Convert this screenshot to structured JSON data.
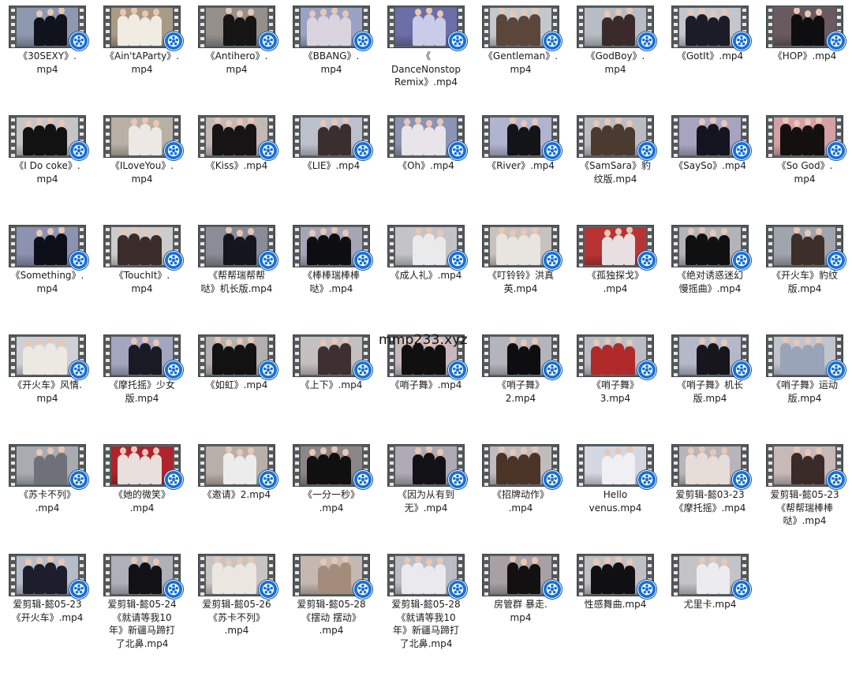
{
  "watermark": "mmp233.xyz",
  "colors": {
    "badge_blue": "#1670d6",
    "film_strip": "#55595c",
    "selection": "none"
  },
  "icons": {
    "file_type_badge": "video-reel-icon",
    "thumbnail_frame": "film-strip-icon"
  },
  "files": [
    {
      "lines": [
        "《30SEXY》.",
        "mp4"
      ],
      "bg": "#8e98b0",
      "fig": "#10131c"
    },
    {
      "lines": [
        "《Ain'tAParty》.",
        "mp4"
      ],
      "bg": "#a89a84",
      "fig": "#f0ece4"
    },
    {
      "lines": [
        "《Antihero》.",
        "mp4"
      ],
      "bg": "#948f8a",
      "fig": "#151515"
    },
    {
      "lines": [
        "《BBANG》.",
        "mp4"
      ],
      "bg": "#9aa2c4",
      "fig": "#d9d4dd"
    },
    {
      "lines": [
        "《",
        "DanceNonstop",
        "Remix》.mp4"
      ],
      "bg": "#6c6ea8",
      "fig": "#c9cbe8"
    },
    {
      "lines": [
        "《Gentleman》.",
        "mp4"
      ],
      "bg": "#c4c8cc",
      "fig": "#5a463a"
    },
    {
      "lines": [
        "《GodBoy》.",
        "mp4"
      ],
      "bg": "#b8bcc4",
      "fig": "#3a2a2a"
    },
    {
      "lines": [
        "《GotIt》.mp4"
      ],
      "bg": "#c4c6cc",
      "fig": "#1c1c28"
    },
    {
      "lines": [
        "《HOP》.mp4"
      ],
      "bg": "#6a5a60",
      "fig": "#0e0e10"
    },
    {
      "lines": [
        "《I Do coke》.",
        "mp4"
      ],
      "bg": "#c6c4c4",
      "fig": "#121212"
    },
    {
      "lines": [
        "《ILoveYou》.",
        "mp4"
      ],
      "bg": "#b8b0a4",
      "fig": "#ece8e4"
    },
    {
      "lines": [
        "《Kiss》.mp4"
      ],
      "bg": "#c4b8b4",
      "fig": "#161414"
    },
    {
      "lines": [
        "《LIE》.mp4"
      ],
      "bg": "#bcc0cc",
      "fig": "#3a2e2e"
    },
    {
      "lines": [
        "《Oh》.mp4"
      ],
      "bg": "#8c94b4",
      "fig": "#e8e4e8"
    },
    {
      "lines": [
        "《River》.mp4"
      ],
      "bg": "#b0b4d0",
      "fig": "#121418"
    },
    {
      "lines": [
        "《SamSara》豹",
        "纹版.mp4"
      ],
      "bg": "#bcbcc0",
      "fig": "#4a3a30"
    },
    {
      "lines": [
        "《SaySo》.mp4"
      ],
      "bg": "#a8a4c0",
      "fig": "#141420"
    },
    {
      "lines": [
        "《So God》.",
        "mp4"
      ],
      "bg": "#d4a0a4",
      "fig": "#141010"
    },
    {
      "lines": [
        "《Something》.",
        "mp4"
      ],
      "bg": "#8c92b0",
      "fig": "#0c0e18"
    },
    {
      "lines": [
        "《TouchIt》.",
        "mp4"
      ],
      "bg": "#cccccc",
      "fig": "#3a2c2a"
    },
    {
      "lines": [
        "《帮帮瑞帮帮",
        "哒》机长版.mp4"
      ],
      "bg": "#8a8c98",
      "fig": "#14161e"
    },
    {
      "lines": [
        "《棒棒瑞棒棒",
        "哒》.mp4"
      ],
      "bg": "#a4a6b8",
      "fig": "#0e0e12"
    },
    {
      "lines": [
        "《成人礼》.mp4"
      ],
      "bg": "#c4c4c8",
      "fig": "#eaeaea"
    },
    {
      "lines": [
        "《叮铃铃》洪真",
        "英.mp4"
      ],
      "bg": "#c8c2bc",
      "fig": "#e8e4e0"
    },
    {
      "lines": [
        "《孤独探戈》",
        ".mp4"
      ],
      "bg": "#b83434",
      "fig": "#e8e0e0"
    },
    {
      "lines": [
        "《绝对诱惑迷幻",
        "慢摇曲》.mp4"
      ],
      "bg": "#b4b4b8",
      "fig": "#101010"
    },
    {
      "lines": [
        "《开火车》豹纹",
        "版.mp4"
      ],
      "bg": "#a0a4ac",
      "fig": "#3c2e28"
    },
    {
      "lines": [
        "《开火车》风情.",
        "mp4"
      ],
      "bg": "#d0d0d4",
      "fig": "#ece8e2"
    },
    {
      "lines": [
        "《摩托摇》少女",
        "版.mp4"
      ],
      "bg": "#a4a6c0",
      "fig": "#1a1a24"
    },
    {
      "lines": [
        "《如虹》.mp4"
      ],
      "bg": "#b4b0b0",
      "fig": "#121212"
    },
    {
      "lines": [
        "《上下》.mp4"
      ],
      "bg": "#c4c0c0",
      "fig": "#3e3030"
    },
    {
      "lines": [
        "《哨子舞》.mp4"
      ],
      "bg": "#c8b8bc",
      "fig": "#101010"
    },
    {
      "lines": [
        "《哨子舞》",
        "2.mp4"
      ],
      "bg": "#b4b4bc",
      "fig": "#0e0e10"
    },
    {
      "lines": [
        "《哨子舞》",
        "3.mp4"
      ],
      "bg": "#bcbcc4",
      "fig": "#b02a2a"
    },
    {
      "lines": [
        "《哨子舞》机长",
        "版.mp4"
      ],
      "bg": "#b4b8c8",
      "fig": "#16161c"
    },
    {
      "lines": [
        "《哨子舞》运动",
        "版.mp4"
      ],
      "bg": "#c0c4cc",
      "fig": "#9aa4b8"
    },
    {
      "lines": [
        "《苏卡不列》",
        ".mp4"
      ],
      "bg": "#a8acb0",
      "fig": "#6e7278"
    },
    {
      "lines": [
        "《她的微笑》",
        ".mp4"
      ],
      "bg": "#b0222c",
      "fig": "#e8e0dc"
    },
    {
      "lines": [
        "《邀请》2.mp4"
      ],
      "bg": "#b8b0a8",
      "fig": "#ececec"
    },
    {
      "lines": [
        "《一分一秒》",
        ".mp4"
      ],
      "bg": "#8c8688",
      "fig": "#101010"
    },
    {
      "lines": [
        "《因为从有到",
        "无》.mp4"
      ],
      "bg": "#b0aab4",
      "fig": "#121216"
    },
    {
      "lines": [
        "《招牌动作》",
        ".mp4"
      ],
      "bg": "#c0bcbc",
      "fig": "#4a3428"
    },
    {
      "lines": [
        "Hello",
        "venus.mp4"
      ],
      "bg": "#d4d6e0",
      "fig": "#f0f0f4"
    },
    {
      "lines": [
        "爱剪辑-懿03-23",
        "《摩托摇》.mp4"
      ],
      "bg": "#b8b4b8",
      "fig": "#e6dcd8"
    },
    {
      "lines": [
        "爱剪辑-懿05-23",
        "《帮帮瑞棒棒",
        "哒》.mp4"
      ],
      "bg": "#c8b8b8",
      "fig": "#3a2a28"
    },
    {
      "lines": [
        "爱剪辑-懿05-23",
        "《开火车》.mp4"
      ],
      "bg": "#b8bcc8",
      "fig": "#1c1e2c"
    },
    {
      "lines": [
        "爱剪辑-懿05-24",
        "《就请等我10",
        "年》新疆马蹄打",
        "了北鼻.mp4"
      ],
      "bg": "#b0b0b8",
      "fig": "#121216"
    },
    {
      "lines": [
        "爱剪辑-懿05-26",
        "《苏卡不列》",
        ".mp4"
      ],
      "bg": "#c8c4c4",
      "fig": "#ece6e0"
    },
    {
      "lines": [
        "爱剪辑-懿05-28",
        "《摆动 摆动》",
        ".mp4"
      ],
      "bg": "#c4b8b0",
      "fig": "#a48c7c"
    },
    {
      "lines": [
        "爱剪辑-懿05-28",
        "《就请等我10",
        "年》新疆马蹄打",
        "了北鼻.mp4"
      ],
      "bg": "#bcbcc4",
      "fig": "#eaeaee"
    },
    {
      "lines": [
        "房管群  暴走.",
        "mp4"
      ],
      "bg": "#a8a0a4",
      "fig": "#121010"
    },
    {
      "lines": [
        "性感舞曲.mp4"
      ],
      "bg": "#c0c0c4",
      "fig": "#101012"
    },
    {
      "lines": [
        "尤里卡.mp4"
      ],
      "bg": "#c4c4c8",
      "fig": "#ececf0"
    }
  ]
}
